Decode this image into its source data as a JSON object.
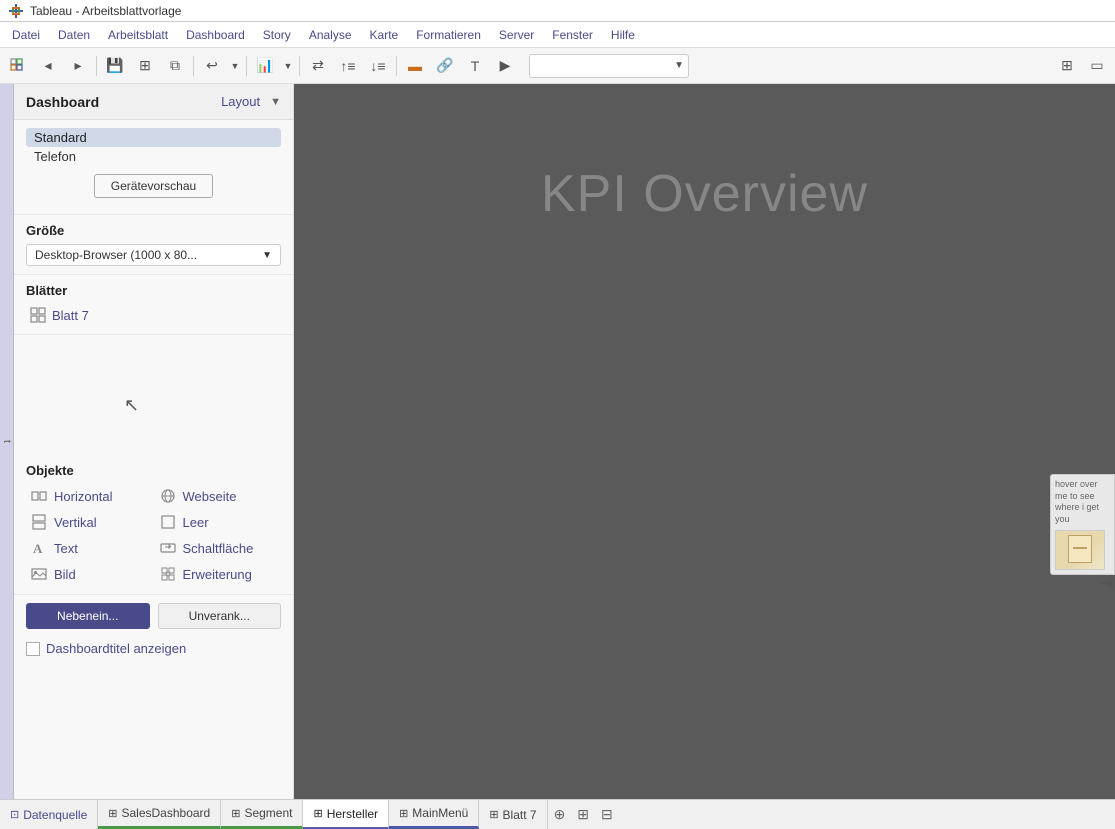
{
  "titleBar": {
    "text": "Tableau - Arbeitsblattvorlage"
  },
  "menuBar": {
    "items": [
      "Datei",
      "Daten",
      "Arbeitsblatt",
      "Dashboard",
      "Story",
      "Analyse",
      "Karte",
      "Formatieren",
      "Server",
      "Fenster",
      "Hilfe"
    ]
  },
  "toolbar": {
    "dropdown_placeholder": "",
    "right_dropdown_placeholder": ""
  },
  "sidebar": {
    "title": "Dashboard",
    "layout_tab": "Layout",
    "layout_arrow": "▼",
    "device_standard": "Standard",
    "device_telefon": "Telefon",
    "device_preview_btn": "Gerätevorschau",
    "section_size": "Größe",
    "size_dropdown": "Desktop-Browser (1000 x 80...",
    "section_blaetter": "Blätter",
    "sheet_item": "Blatt 7",
    "section_objekte": "Objekte",
    "objects": [
      {
        "label": "Horizontal",
        "icon": "⊞"
      },
      {
        "label": "Webseite",
        "icon": "⊕"
      },
      {
        "label": "Vertikal",
        "icon": "⊟"
      },
      {
        "label": "Leer",
        "icon": "□"
      },
      {
        "label": "Text",
        "icon": "A"
      },
      {
        "label": "Schaltfläche",
        "icon": "⊡"
      },
      {
        "label": "Bild",
        "icon": "⊠"
      },
      {
        "label": "Erweiterung",
        "icon": "⊞"
      }
    ],
    "layout_btn_nebenein": "Nebenein...",
    "layout_btn_unverank": "Unverank...",
    "show_title_label": "Dashboardtitel anzeigen"
  },
  "canvas": {
    "kpi_title": "KPI Overview"
  },
  "hoverPanel": {
    "text": "hover over me to see where i get you"
  },
  "bottomTabs": {
    "tabs": [
      {
        "label": "Datenquelle",
        "icon": "⊡",
        "type": "datasource"
      },
      {
        "label": "SalesDashboard",
        "icon": "⊞",
        "type": "dashboard",
        "underline": "green"
      },
      {
        "label": "Segment",
        "icon": "⊞",
        "type": "sheet",
        "underline": "green"
      },
      {
        "label": "Hersteller",
        "icon": "⊞",
        "type": "sheet",
        "underline": "orange",
        "active": true
      },
      {
        "label": "MainMenü",
        "icon": "⊞",
        "type": "dashboard",
        "underline": "blue"
      },
      {
        "label": "Blatt 7",
        "icon": "⊞",
        "type": "sheet"
      }
    ],
    "add_btn1": "⊕",
    "add_btn2": "⊕",
    "add_btn3": "⊕"
  },
  "leftEdge": {
    "label": "t"
  }
}
